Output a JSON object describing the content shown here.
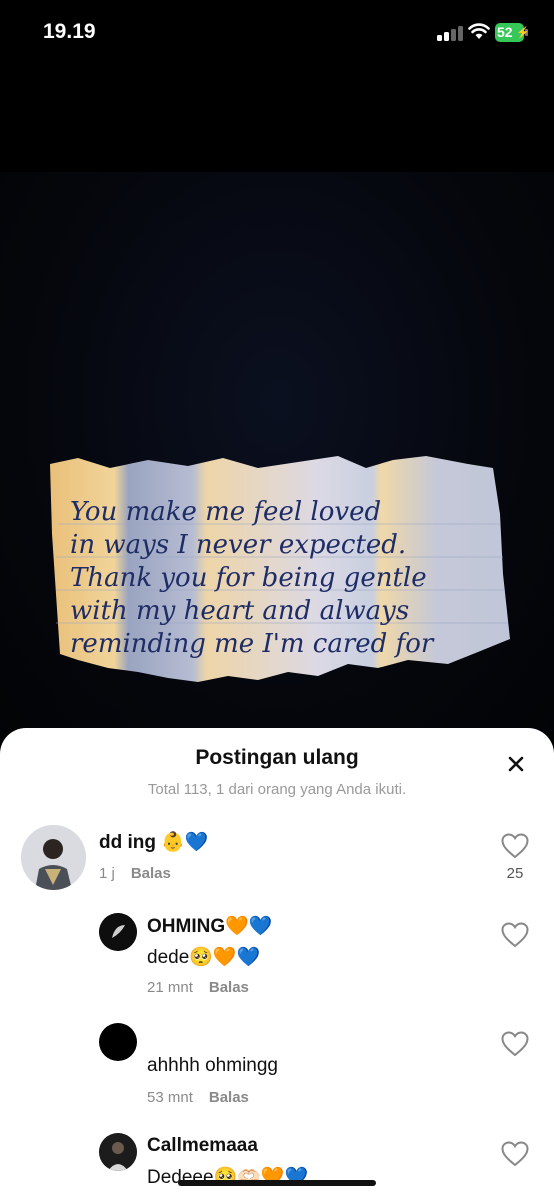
{
  "status": {
    "time": "19.19",
    "battery": "52"
  },
  "photo": {
    "note_lines": [
      "You make me feel loved",
      "in ways I never expected.",
      "Thank you for being gentle",
      "with my heart and always",
      "reminding me I'm cared for"
    ]
  },
  "sheet": {
    "title": "Postingan ulang",
    "subtitle": "Total 113, 1 dari orang yang Anda ikuti."
  },
  "comments": [
    {
      "name": "dd ing 👶💙",
      "text": "",
      "time": "1 j",
      "reply": "Balas",
      "likes": "25"
    },
    {
      "name": "OHMING🧡💙",
      "text": "dede🥺🧡💙",
      "time": "21 mnt",
      "reply": "Balas"
    },
    {
      "name": "",
      "text": "ahhhh ohmingg",
      "time": "53 mnt",
      "reply": "Balas"
    },
    {
      "name": "Callmemaaa",
      "text": "Dedeee🥺🫶🏻🧡💙"
    }
  ],
  "colors": {
    "accent_heart": "#888888",
    "battery": "#36c759"
  }
}
